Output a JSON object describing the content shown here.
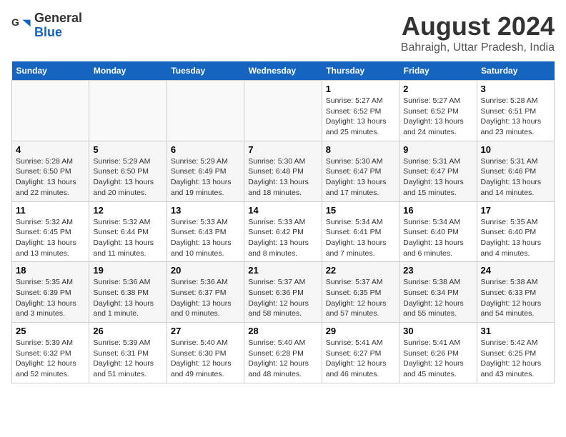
{
  "header": {
    "logo_line1": "General",
    "logo_line2": "Blue",
    "title": "August 2024",
    "subtitle": "Bahraigh, Uttar Pradesh, India"
  },
  "days_of_week": [
    "Sunday",
    "Monday",
    "Tuesday",
    "Wednesday",
    "Thursday",
    "Friday",
    "Saturday"
  ],
  "weeks": [
    [
      {
        "day": "",
        "info": ""
      },
      {
        "day": "",
        "info": ""
      },
      {
        "day": "",
        "info": ""
      },
      {
        "day": "",
        "info": ""
      },
      {
        "day": "1",
        "info": "Sunrise: 5:27 AM\nSunset: 6:52 PM\nDaylight: 13 hours\nand 25 minutes."
      },
      {
        "day": "2",
        "info": "Sunrise: 5:27 AM\nSunset: 6:52 PM\nDaylight: 13 hours\nand 24 minutes."
      },
      {
        "day": "3",
        "info": "Sunrise: 5:28 AM\nSunset: 6:51 PM\nDaylight: 13 hours\nand 23 minutes."
      }
    ],
    [
      {
        "day": "4",
        "info": "Sunrise: 5:28 AM\nSunset: 6:50 PM\nDaylight: 13 hours\nand 22 minutes."
      },
      {
        "day": "5",
        "info": "Sunrise: 5:29 AM\nSunset: 6:50 PM\nDaylight: 13 hours\nand 20 minutes."
      },
      {
        "day": "6",
        "info": "Sunrise: 5:29 AM\nSunset: 6:49 PM\nDaylight: 13 hours\nand 19 minutes."
      },
      {
        "day": "7",
        "info": "Sunrise: 5:30 AM\nSunset: 6:48 PM\nDaylight: 13 hours\nand 18 minutes."
      },
      {
        "day": "8",
        "info": "Sunrise: 5:30 AM\nSunset: 6:47 PM\nDaylight: 13 hours\nand 17 minutes."
      },
      {
        "day": "9",
        "info": "Sunrise: 5:31 AM\nSunset: 6:47 PM\nDaylight: 13 hours\nand 15 minutes."
      },
      {
        "day": "10",
        "info": "Sunrise: 5:31 AM\nSunset: 6:46 PM\nDaylight: 13 hours\nand 14 minutes."
      }
    ],
    [
      {
        "day": "11",
        "info": "Sunrise: 5:32 AM\nSunset: 6:45 PM\nDaylight: 13 hours\nand 13 minutes."
      },
      {
        "day": "12",
        "info": "Sunrise: 5:32 AM\nSunset: 6:44 PM\nDaylight: 13 hours\nand 11 minutes."
      },
      {
        "day": "13",
        "info": "Sunrise: 5:33 AM\nSunset: 6:43 PM\nDaylight: 13 hours\nand 10 minutes."
      },
      {
        "day": "14",
        "info": "Sunrise: 5:33 AM\nSunset: 6:42 PM\nDaylight: 13 hours\nand 8 minutes."
      },
      {
        "day": "15",
        "info": "Sunrise: 5:34 AM\nSunset: 6:41 PM\nDaylight: 13 hours\nand 7 minutes."
      },
      {
        "day": "16",
        "info": "Sunrise: 5:34 AM\nSunset: 6:40 PM\nDaylight: 13 hours\nand 6 minutes."
      },
      {
        "day": "17",
        "info": "Sunrise: 5:35 AM\nSunset: 6:40 PM\nDaylight: 13 hours\nand 4 minutes."
      }
    ],
    [
      {
        "day": "18",
        "info": "Sunrise: 5:35 AM\nSunset: 6:39 PM\nDaylight: 13 hours\nand 3 minutes."
      },
      {
        "day": "19",
        "info": "Sunrise: 5:36 AM\nSunset: 6:38 PM\nDaylight: 13 hours\nand 1 minute."
      },
      {
        "day": "20",
        "info": "Sunrise: 5:36 AM\nSunset: 6:37 PM\nDaylight: 13 hours\nand 0 minutes."
      },
      {
        "day": "21",
        "info": "Sunrise: 5:37 AM\nSunset: 6:36 PM\nDaylight: 12 hours\nand 58 minutes."
      },
      {
        "day": "22",
        "info": "Sunrise: 5:37 AM\nSunset: 6:35 PM\nDaylight: 12 hours\nand 57 minutes."
      },
      {
        "day": "23",
        "info": "Sunrise: 5:38 AM\nSunset: 6:34 PM\nDaylight: 12 hours\nand 55 minutes."
      },
      {
        "day": "24",
        "info": "Sunrise: 5:38 AM\nSunset: 6:33 PM\nDaylight: 12 hours\nand 54 minutes."
      }
    ],
    [
      {
        "day": "25",
        "info": "Sunrise: 5:39 AM\nSunset: 6:32 PM\nDaylight: 12 hours\nand 52 minutes."
      },
      {
        "day": "26",
        "info": "Sunrise: 5:39 AM\nSunset: 6:31 PM\nDaylight: 12 hours\nand 51 minutes."
      },
      {
        "day": "27",
        "info": "Sunrise: 5:40 AM\nSunset: 6:30 PM\nDaylight: 12 hours\nand 49 minutes."
      },
      {
        "day": "28",
        "info": "Sunrise: 5:40 AM\nSunset: 6:28 PM\nDaylight: 12 hours\nand 48 minutes."
      },
      {
        "day": "29",
        "info": "Sunrise: 5:41 AM\nSunset: 6:27 PM\nDaylight: 12 hours\nand 46 minutes."
      },
      {
        "day": "30",
        "info": "Sunrise: 5:41 AM\nSunset: 6:26 PM\nDaylight: 12 hours\nand 45 minutes."
      },
      {
        "day": "31",
        "info": "Sunrise: 5:42 AM\nSunset: 6:25 PM\nDaylight: 12 hours\nand 43 minutes."
      }
    ]
  ]
}
